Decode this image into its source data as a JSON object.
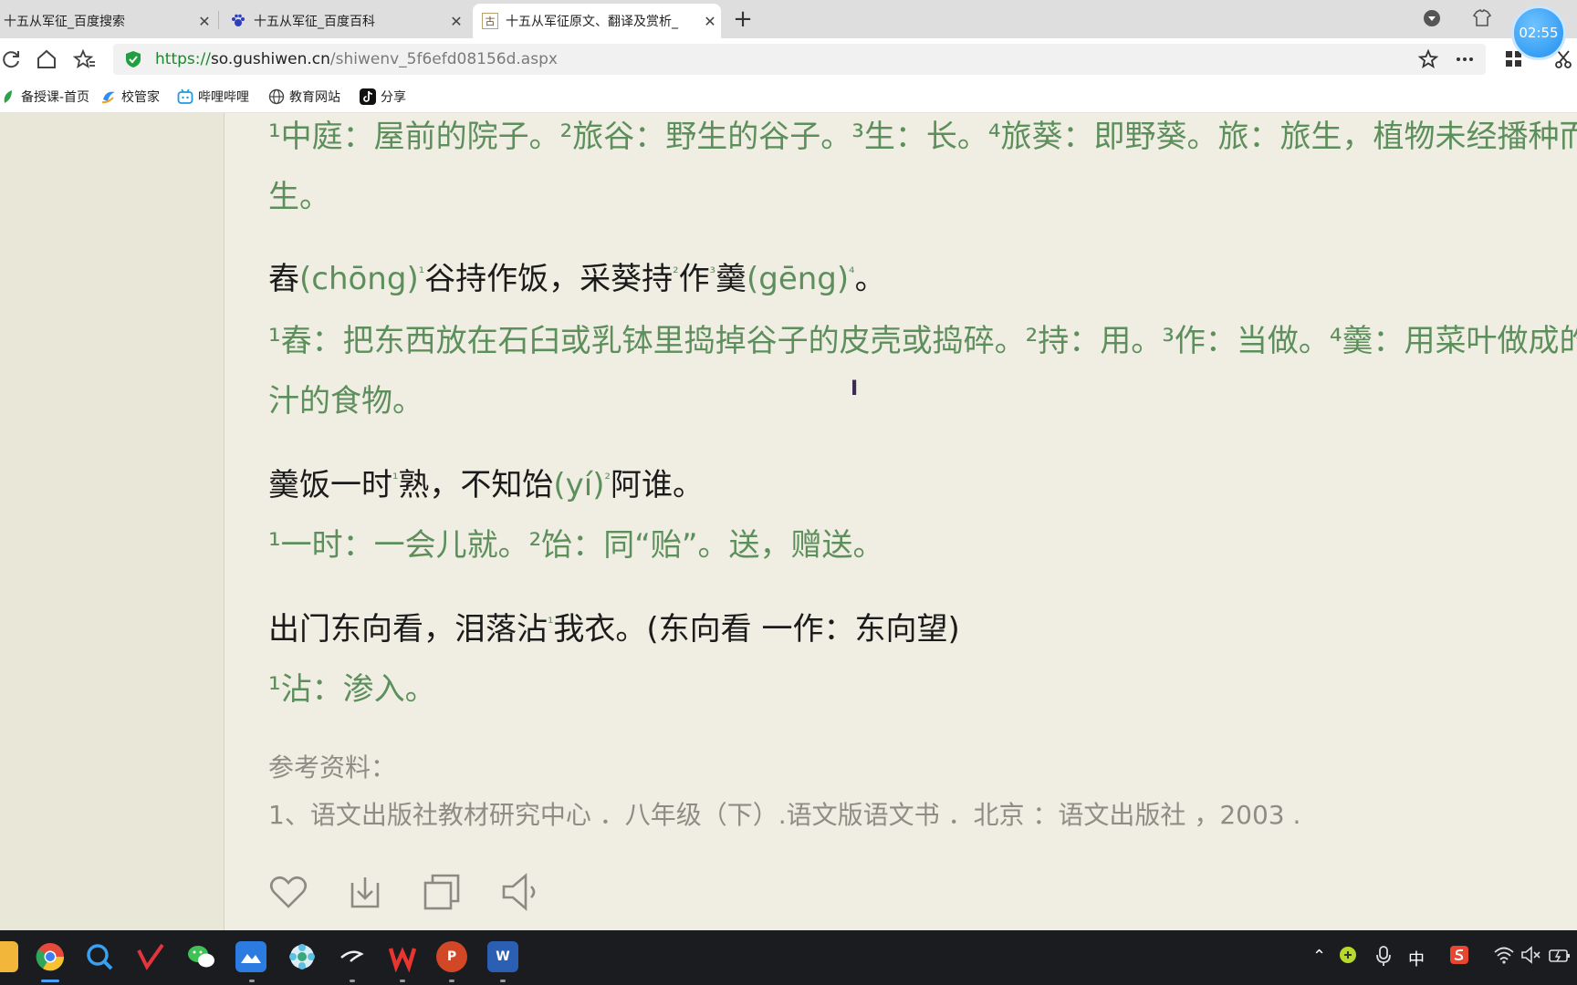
{
  "browser": {
    "tabs": [
      {
        "label": "十五从军征_百度搜索",
        "icon": "baidu-search-icon",
        "active": false
      },
      {
        "label": "十五从军征_百度百科",
        "icon": "baidu-paw-icon",
        "active": false
      },
      {
        "label": "十五从军征原文、翻译及赏析_",
        "icon": "gushiwen-icon",
        "active": true
      }
    ],
    "tab_icon_glyph_3": "古",
    "new_tab": "+",
    "clock": "02:55",
    "url_proto": "https://",
    "url_host": "so.gushiwen.cn",
    "url_path": "/shiwenv_5f6efd08156d.aspx",
    "bookmarks": [
      {
        "label": "备授课-首页",
        "icon": "leaf-icon"
      },
      {
        "label": "校管家",
        "icon": "logo-icon"
      },
      {
        "label": "哔哩哔哩",
        "icon": "bilibili-icon"
      },
      {
        "label": "教育网站",
        "icon": "globe-icon"
      },
      {
        "label": "分享",
        "icon": "tiktok-icon"
      }
    ]
  },
  "article": {
    "note_1a": "¹中庭：屋前的院子。²旅谷：野生的谷子。³生：长。⁴旅葵：即野葵。旅：旅生，植物未经播种而野",
    "note_1b": "生。",
    "l2_a": "舂",
    "l2_pin1": "(chōng)",
    "l2_s1": "¹",
    "l2_b": "谷持作饭，采葵持",
    "l2_s2": "²",
    "l2_c": "作",
    "l2_s3": "³",
    "l2_d": "羹",
    "l2_pin2": "(gēng)",
    "l2_s4": "⁴",
    "l2_e": "。",
    "note_2a": "¹舂：把东西放在石臼或乳钵里捣掉谷子的皮壳或捣碎。²持：用。³作：当做。⁴羹：用菜叶做成的带",
    "note_2b": "汁的食物。",
    "l3_a": "羹饭一时",
    "l3_s1": "¹",
    "l3_b": "熟，不知饴",
    "l3_pin1": "(yí)",
    "l3_s2": "²",
    "l3_c": "阿谁。",
    "note_3": "¹一时：一会儿就。²饴：同“贻”。送，赠送。",
    "l4_a": "出门东向看，泪落沾",
    "l4_s1": "¹",
    "l4_b": "我衣。(东向看 一作：东向望)",
    "note_4": "¹沾：渗入。",
    "ref_title": "参考资料：",
    "ref_item": "1、语文出版社教材研究中心 ．八年级（下）.语文版语文书 ．北京 ：语文出版社 ，2003 ."
  },
  "actions": [
    "heart-icon",
    "download-icon",
    "copy-icon",
    "speaker-icon"
  ],
  "taskbar": {
    "apps": [
      "file-explorer-icon",
      "chrome-icon",
      "search-app-icon",
      "vscode-like-icon",
      "wechat-icon",
      "meeting-icon",
      "settings-flower-icon",
      "terminal-icon",
      "wps-icon",
      "powerpoint-icon",
      "word-icon"
    ],
    "ime": "中",
    "ppt_letter": "P",
    "word_letter": "W"
  },
  "colors": {
    "page_bg": "#f0eee2",
    "note_green": "#5d8f5d",
    "taskbar": "#1b1c20"
  }
}
